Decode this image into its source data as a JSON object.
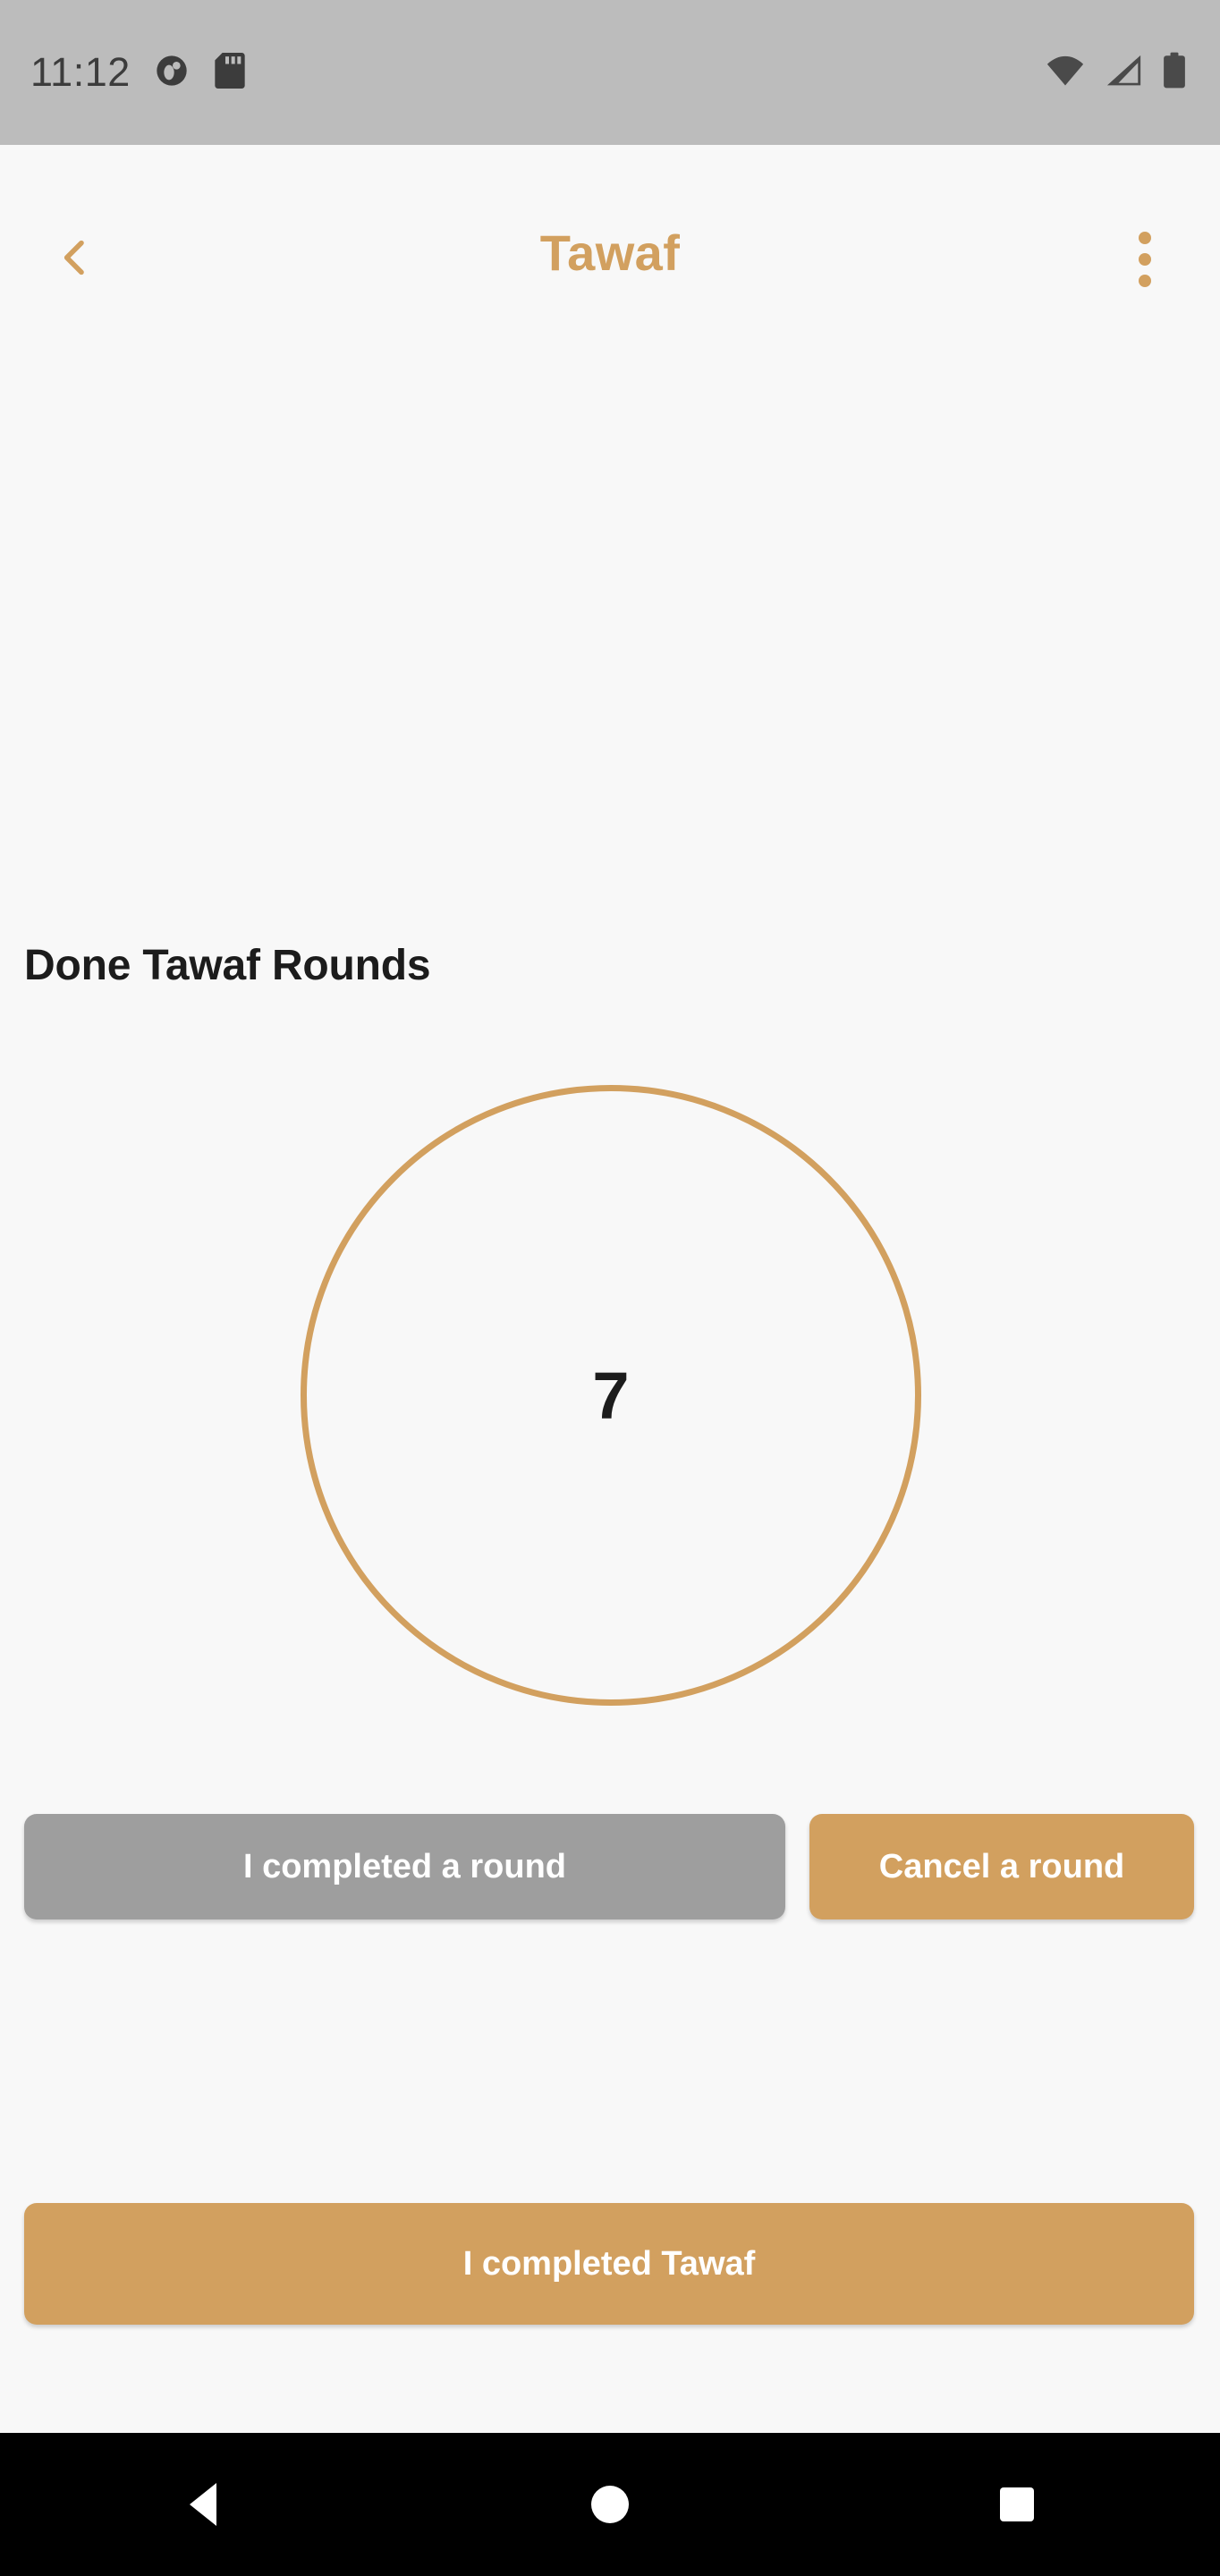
{
  "status_bar": {
    "time": "11:12",
    "left_icons": [
      {
        "name": "app-notification-icon"
      },
      {
        "name": "sd-card-icon"
      }
    ],
    "right_icons": [
      {
        "name": "wifi-icon"
      },
      {
        "name": "cellular-signal-icon"
      },
      {
        "name": "battery-icon"
      }
    ],
    "background_color": "#BCBCBC"
  },
  "app_bar": {
    "title": "Tawaf",
    "back_icon": "chevron-left-icon",
    "overflow_icon": "more-vertical-icon",
    "accent_color": "#D2A05F"
  },
  "content": {
    "section_heading": "Done Tawaf Rounds",
    "counter": {
      "value": "7",
      "ring_color": "#D2A05F"
    }
  },
  "actions": {
    "completed_round_label": "I completed a round",
    "completed_round_color": "#9E9E9E",
    "cancel_round_label": "Cancel a round",
    "cancel_round_color": "#D2A05F",
    "completed_tawaf_label": "I completed Tawaf",
    "completed_tawaf_color": "#D2A05F"
  },
  "nav_bar": {
    "back_icon": "triangle-back-icon",
    "home_icon": "circle-home-icon",
    "recents_icon": "square-recents-icon",
    "background_color": "#000000"
  }
}
